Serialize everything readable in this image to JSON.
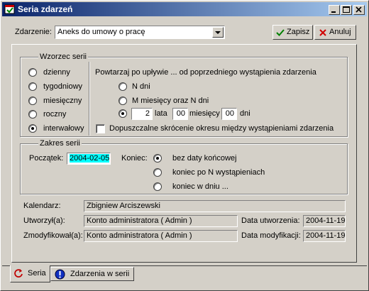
{
  "window": {
    "title": "Seria zdarzeń"
  },
  "toolbar": {
    "event_label": "Zdarzenie:",
    "event_value": "Aneks do umowy o pracę",
    "save_label": "Zapisz",
    "cancel_label": "Anuluj"
  },
  "pattern": {
    "title": "Wzorzec serii",
    "types": [
      "dzienny",
      "tygodniowy",
      "miesięczny",
      "roczny",
      "interwałowy"
    ],
    "selected_type": "interwałowy",
    "repeat_text": "Powtarzaj po upływie ... od poprzedniego wystąpienia zdarzenia",
    "opt_days": "N dni",
    "opt_months_days": "M miesięcy oraz N dni",
    "years_value": "2",
    "years_label": "lata",
    "months_value": "00",
    "months_label": "miesięcy",
    "days_value": "00",
    "days_label": "dni",
    "allow_shorten_label": "Dopuszczalne skrócenie okresu między wystąpieniami zdarzenia",
    "allow_shorten_checked": false
  },
  "range": {
    "title": "Zakres serii",
    "start_label": "Początek:",
    "start_value": "2004-02-05",
    "end_label": "Koniec:",
    "end_options": [
      "bez daty końcowej",
      "koniec po N wystąpieniach",
      "koniec w dniu ..."
    ],
    "end_selected": "bez daty końcowej"
  },
  "info": {
    "calendar_label": "Kalendarz:",
    "calendar_value": "Zbigniew Arciszewski",
    "created_by_label": "Utworzył(a):",
    "created_by_value": "Konto administratora ( Admin )",
    "created_date_label": "Data utworzenia:",
    "created_date_value": "2004-11-19",
    "modified_by_label": "Zmodyfikował(a):",
    "modified_by_value": "Konto administratora ( Admin )",
    "modified_date_label": "Data modyfikacji:",
    "modified_date_value": "2004-11-19"
  },
  "tabs": [
    {
      "label": "Seria",
      "icon": "series-icon",
      "active": true
    },
    {
      "label": "Zdarzenia w serii",
      "icon": "info-icon",
      "active": false
    }
  ],
  "colors": {
    "titlebar_start": "#0a246a",
    "titlebar_end": "#a6caf0",
    "date_highlight": "#00ffff",
    "face": "#d4d0c8"
  }
}
